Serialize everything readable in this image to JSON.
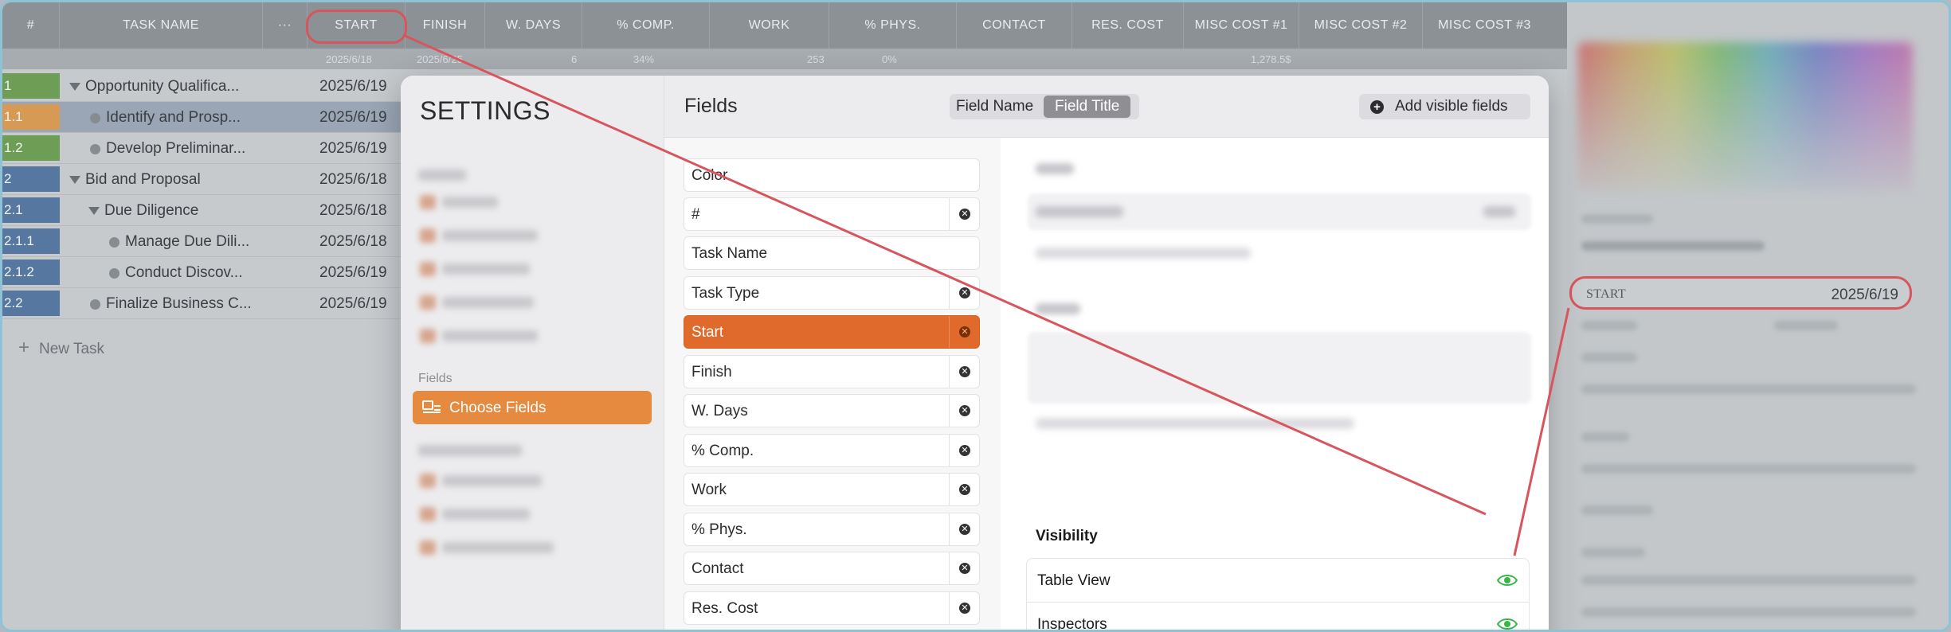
{
  "table": {
    "columns": [
      "#",
      "TASK NAME",
      "···",
      "START",
      "FINISH",
      "W. DAYS",
      "% COMP.",
      "WORK",
      "% PHYS.",
      "CONTACT",
      "RES. COST",
      "MISC COST #1",
      "MISC COST #2",
      "MISC COST #3"
    ],
    "summary": {
      "start": "2025/6/18",
      "finish": "2025/6/25",
      "wdays": "6",
      "comp": "34%",
      "work": "253",
      "phys": "0%",
      "rescost": "1,278.5$"
    },
    "rows": [
      {
        "num": "1",
        "name": "Opportunity Qualifica...",
        "start": "2025/6/19",
        "color": "#6e9e55",
        "kind": "group"
      },
      {
        "num": "1.1",
        "name": "Identify and Prosp...",
        "start": "2025/6/19",
        "color": "#d69a55",
        "kind": "task"
      },
      {
        "num": "1.2",
        "name": "Develop Preliminar...",
        "start": "2025/6/19",
        "color": "#6e9e55",
        "kind": "task"
      },
      {
        "num": "2",
        "name": "Bid and Proposal",
        "start": "2025/6/18",
        "color": "#5577a0",
        "kind": "group"
      },
      {
        "num": "2.1",
        "name": "Due Diligence",
        "start": "2025/6/18",
        "color": "#5577a0",
        "kind": "subgroup"
      },
      {
        "num": "2.1.1",
        "name": "Manage Due Dili...",
        "start": "2025/6/18",
        "color": "#5577a0",
        "kind": "subtask"
      },
      {
        "num": "2.1.2",
        "name": "Conduct Discov...",
        "start": "2025/6/19",
        "color": "#5577a0",
        "kind": "subtask"
      },
      {
        "num": "2.2",
        "name": "Finalize Business C...",
        "start": "2025/6/19",
        "color": "#5577a0",
        "kind": "task"
      }
    ],
    "new_task": "New Task"
  },
  "inspector": {
    "start_label": "START",
    "start_value": "2025/6/19"
  },
  "settings": {
    "title": "SETTINGS",
    "fields_section": "Fields",
    "choose_fields": "Choose Fields"
  },
  "fields_panel": {
    "title": "Fields",
    "toggle": {
      "option1": "Field Name",
      "option2": "Field Title"
    },
    "add_visible": "Add visible fields",
    "items": [
      {
        "name": "Color",
        "removable": false
      },
      {
        "name": "#",
        "removable": true
      },
      {
        "name": "Task Name",
        "removable": false
      },
      {
        "name": "Task Type",
        "removable": true
      },
      {
        "name": "Start",
        "removable": true,
        "selected": true
      },
      {
        "name": "Finish",
        "removable": true
      },
      {
        "name": "W. Days",
        "removable": true
      },
      {
        "name": "% Comp.",
        "removable": true
      },
      {
        "name": "Work",
        "removable": true
      },
      {
        "name": "% Phys.",
        "removable": true
      },
      {
        "name": "Contact",
        "removable": true
      },
      {
        "name": "Res. Cost",
        "removable": true
      }
    ],
    "visibility": {
      "title": "Visibility",
      "table_view": "Table View",
      "inspectors": "Inspectors"
    }
  },
  "colors": {
    "accent_orange": "#e06a2b",
    "highlight_red": "#d8555d",
    "eye_green": "#39b54a"
  }
}
